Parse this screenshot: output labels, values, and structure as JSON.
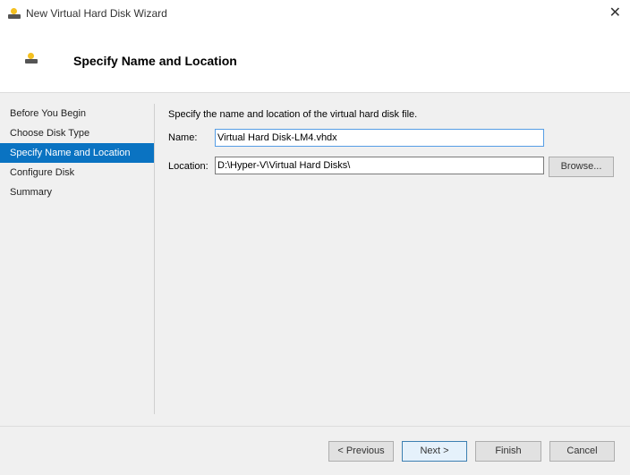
{
  "window": {
    "title": "New Virtual Hard Disk Wizard",
    "close_icon": "close-icon"
  },
  "header": {
    "title": "Specify Name and Location",
    "icon": "hard-disk-icon"
  },
  "sidebar": {
    "items": [
      {
        "label": "Before You Begin",
        "active": false
      },
      {
        "label": "Choose Disk Type",
        "active": false
      },
      {
        "label": "Specify Name and Location",
        "active": true
      },
      {
        "label": "Configure Disk",
        "active": false
      },
      {
        "label": "Summary",
        "active": false
      }
    ]
  },
  "form": {
    "description": "Specify the name and location of the virtual hard disk file.",
    "name_label": "Name:",
    "name_value": "Virtual Hard Disk-LM4.vhdx",
    "location_label": "Location:",
    "location_value": "D:\\Hyper-V\\Virtual Hard Disks\\",
    "browse_label": "Browse..."
  },
  "footer": {
    "previous": "< Previous",
    "next": "Next >",
    "finish": "Finish",
    "cancel": "Cancel"
  },
  "colors": {
    "accent": "#0a73c2"
  }
}
